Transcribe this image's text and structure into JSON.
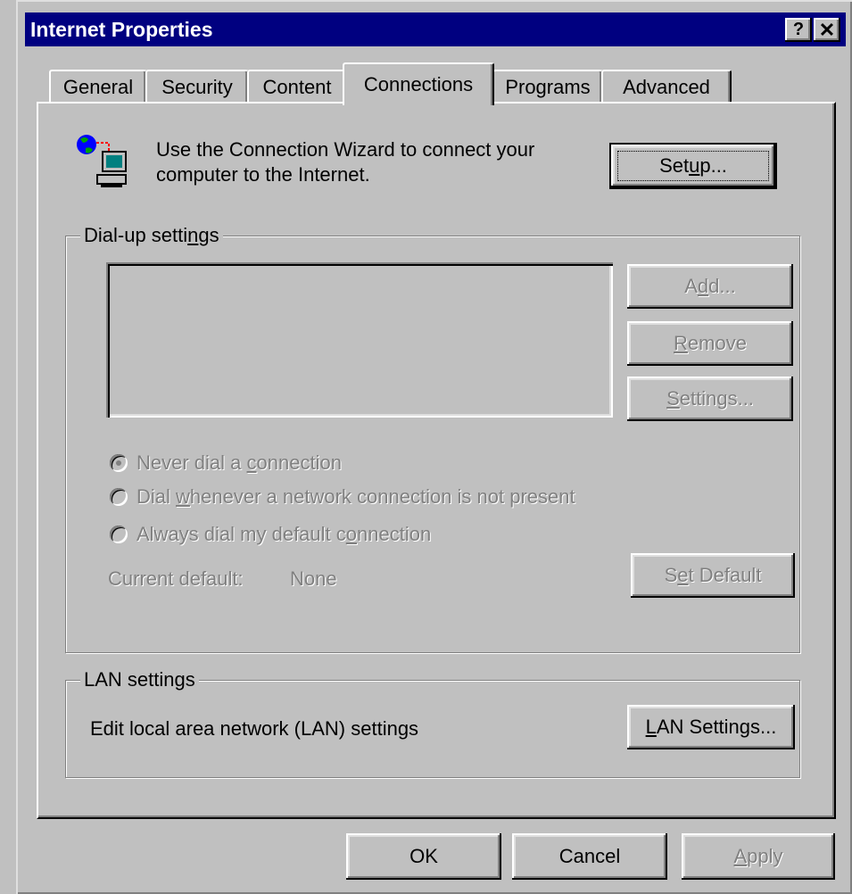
{
  "window": {
    "title": "Internet Properties",
    "help_label": "?",
    "close_label": "✕"
  },
  "tabs": [
    {
      "label": "General"
    },
    {
      "label": "Security"
    },
    {
      "label": "Content"
    },
    {
      "label": "Connections",
      "active": true
    },
    {
      "label": "Programs"
    },
    {
      "label": "Advanced"
    }
  ],
  "wizard": {
    "text_line1": "Use the Connection Wizard to connect your",
    "text_line2": "computer to the Internet.",
    "setup_pre": "Set",
    "setup_u": "u",
    "setup_post": "p...",
    "icon": "network-computer-icon"
  },
  "dialup": {
    "legend_pre": "Dial-up setti",
    "legend_u": "n",
    "legend_post": "gs",
    "add_pre": "A",
    "add_u": "d",
    "add_post": "d...",
    "remove_u": "R",
    "remove_post": "emove",
    "settings_u": "S",
    "settings_post": "ettings...",
    "radio1_pre": "Never dial a ",
    "radio1_u": "c",
    "radio1_post": "onnection",
    "radio2_pre": "Dial ",
    "radio2_u": "w",
    "radio2_post": "henever a network connection is not present",
    "radio3_pre": "Always dial my default c",
    "radio3_u": "o",
    "radio3_post": "nnection",
    "current_default_label": "Current default:",
    "current_default_value": "None",
    "set_default_pre": "S",
    "set_default_u": "e",
    "set_default_post": "t Default"
  },
  "lan": {
    "legend": "LAN settings",
    "description": "Edit local area network (LAN) settings",
    "button_u": "L",
    "button_post": "AN Settings..."
  },
  "footer": {
    "ok": "OK",
    "cancel": "Cancel",
    "apply_u": "A",
    "apply_post": "pply"
  },
  "colors": {
    "titlebar": "#000080",
    "face": "#c0c0c0",
    "disabled_text": "#808080"
  }
}
